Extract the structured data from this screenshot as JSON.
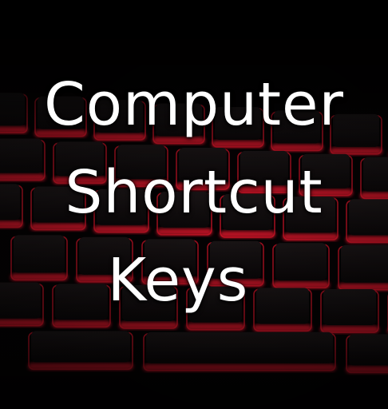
{
  "title": {
    "line1": "Computer",
    "line2": "Shortcut",
    "line3": "Keys"
  },
  "colors": {
    "background": "#000000",
    "key_glow": "#e0162b",
    "text": "#ffffff"
  }
}
